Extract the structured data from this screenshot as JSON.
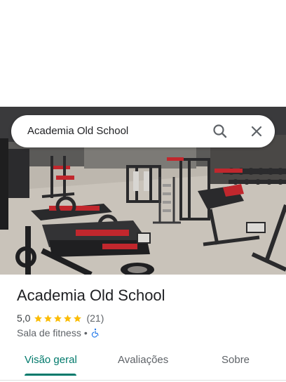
{
  "search": {
    "query": "Academia Old School"
  },
  "place": {
    "name": "Academia Old School",
    "rating": "5,0",
    "stars": 5,
    "review_count": "(21)",
    "category": "Sala de fitness",
    "separator": "•"
  },
  "tabs": [
    {
      "label": "Visão geral",
      "active": true
    },
    {
      "label": "Avaliações",
      "active": false
    },
    {
      "label": "Sobre",
      "active": false
    }
  ],
  "colors": {
    "accent": "#00796b",
    "star": "#fbbc04",
    "accessibility": "#1a73e8"
  },
  "icons": {
    "search": "search-icon",
    "close": "close-icon",
    "accessibility": "wheelchair-icon"
  }
}
